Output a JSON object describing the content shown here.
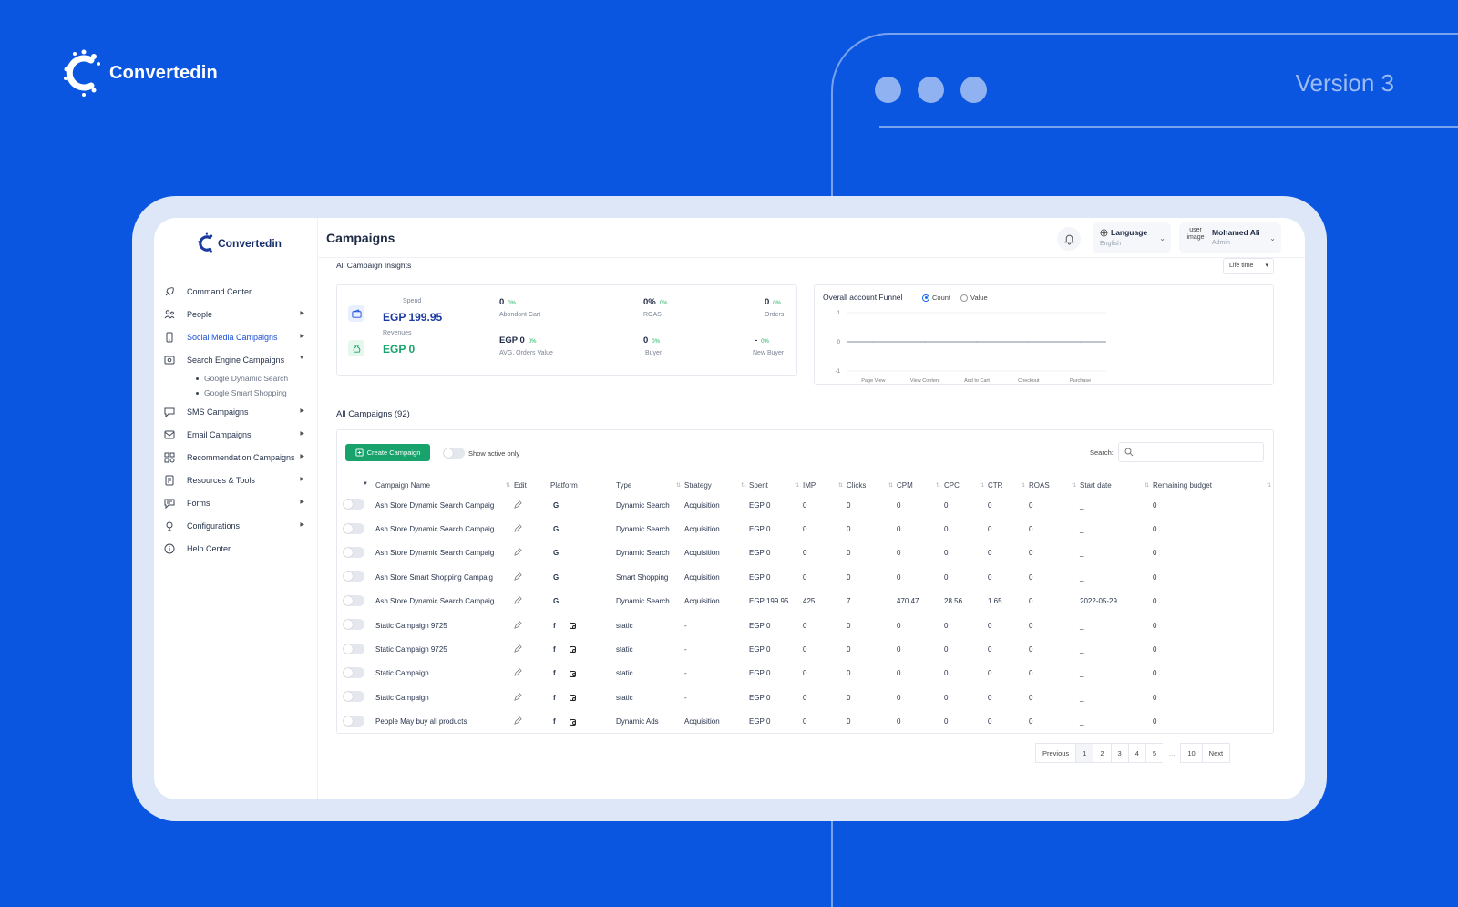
{
  "backdrop": {
    "brand": "Convertedin",
    "version": "Version 3"
  },
  "sidebar": {
    "brand": "Convertedin",
    "items": [
      {
        "label": "Command Center",
        "icon": "rocket-icon",
        "has_chevron": false
      },
      {
        "label": "People",
        "icon": "people-icon",
        "has_chevron": true
      },
      {
        "label": "Social Media Campaigns",
        "icon": "phone-icon",
        "has_chevron": true,
        "active": true
      },
      {
        "label": "Search Engine Campaigns",
        "icon": "search-engine-icon",
        "has_chevron": true,
        "expanded": true
      },
      {
        "label": "SMS Campaigns",
        "icon": "sms-icon",
        "has_chevron": true
      },
      {
        "label": "Email Campaigns",
        "icon": "email-icon",
        "has_chevron": true
      },
      {
        "label": "Recommendation Campaigns",
        "icon": "grid-icon",
        "has_chevron": true
      },
      {
        "label": "Resources & Tools",
        "icon": "tools-icon",
        "has_chevron": true
      },
      {
        "label": "Forms",
        "icon": "forms-icon",
        "has_chevron": true
      },
      {
        "label": "Configurations",
        "icon": "config-icon",
        "has_chevron": true
      },
      {
        "label": "Help Center",
        "icon": "help-icon",
        "has_chevron": false
      }
    ],
    "sub_items": [
      "Google Dynamic Search",
      "Google Smart Shopping"
    ]
  },
  "header": {
    "title": "Campaigns",
    "language_label": "Language",
    "language_value": "English",
    "user_image_alt": "user image",
    "user_name": "Mohamed Ali",
    "user_role": "Admin"
  },
  "insights": {
    "title": "All Campaign Insights",
    "period": "Life time",
    "spend_label": "Spend",
    "spend_value": "EGP 199.95",
    "revenues_label": "Revenues",
    "revenues_value": "EGP 0",
    "metrics": [
      {
        "value": "0",
        "pct": "0%",
        "label": "Abondont Cart"
      },
      {
        "value": "0%",
        "pct": "0%",
        "label": "ROAS"
      },
      {
        "value": "0",
        "pct": "0%",
        "label": "Orders"
      },
      {
        "value": "EGP 0",
        "pct": "0%",
        "label": "AVG. Orders Value"
      },
      {
        "value": "0",
        "pct": "0%",
        "label": "Buyer"
      },
      {
        "value": "-",
        "pct": "0%",
        "label": "New Buyer"
      }
    ]
  },
  "funnel": {
    "title": "Overall account Funnel",
    "option_count": "Count",
    "option_value": "Value",
    "selected": "Count",
    "y_ticks": [
      "1",
      "0",
      "-1"
    ],
    "x_ticks": [
      "Page View",
      "View Content",
      "Add to Cart",
      "Checkout",
      "Purchase"
    ],
    "values": [
      0,
      0,
      0,
      0,
      0
    ]
  },
  "campaigns": {
    "title": "All Campaigns (92)",
    "create_label": "Create Campaign",
    "show_active_label": "Show active only",
    "search_label": "Search:",
    "columns": [
      "Campaign Name",
      "Edit",
      "Platform",
      "Type",
      "Strategy",
      "Spent",
      "IMP.",
      "Clicks",
      "CPM",
      "CPC",
      "CTR",
      "ROAS",
      "Start date",
      "Remaining budget"
    ],
    "rows": [
      {
        "name": "Ash Store Dynamic Search Campaig",
        "platform": "google",
        "type": "Dynamic Search",
        "strategy": "Acquisition",
        "spent": "EGP 0",
        "imp": "0",
        "clicks": "0",
        "cpm": "0",
        "cpc": "0",
        "ctr": "0",
        "roas": "0",
        "start": "_",
        "budget": "0"
      },
      {
        "name": "Ash Store Dynamic Search Campaig",
        "platform": "google",
        "type": "Dynamic Search",
        "strategy": "Acquisition",
        "spent": "EGP 0",
        "imp": "0",
        "clicks": "0",
        "cpm": "0",
        "cpc": "0",
        "ctr": "0",
        "roas": "0",
        "start": "_",
        "budget": "0"
      },
      {
        "name": "Ash Store Dynamic Search Campaig",
        "platform": "google",
        "type": "Dynamic Search",
        "strategy": "Acquisition",
        "spent": "EGP 0",
        "imp": "0",
        "clicks": "0",
        "cpm": "0",
        "cpc": "0",
        "ctr": "0",
        "roas": "0",
        "start": "_",
        "budget": "0"
      },
      {
        "name": "Ash Store Smart Shopping Campaig",
        "platform": "google",
        "type": "Smart Shopping",
        "strategy": "Acquisition",
        "spent": "EGP 0",
        "imp": "0",
        "clicks": "0",
        "cpm": "0",
        "cpc": "0",
        "ctr": "0",
        "roas": "0",
        "start": "_",
        "budget": "0"
      },
      {
        "name": "Ash Store Dynamic Search Campaig",
        "platform": "google",
        "type": "Dynamic Search",
        "strategy": "Acquisition",
        "spent": "EGP 199.95",
        "imp": "425",
        "clicks": "7",
        "cpm": "470.47",
        "cpc": "28.56",
        "ctr": "1.65",
        "roas": "0",
        "start": "2022-05-29",
        "budget": "0"
      },
      {
        "name": "Static Campaign 9725",
        "platform": "meta",
        "type": "static",
        "strategy": "-",
        "spent": "EGP 0",
        "imp": "0",
        "clicks": "0",
        "cpm": "0",
        "cpc": "0",
        "ctr": "0",
        "roas": "0",
        "start": "_",
        "budget": "0"
      },
      {
        "name": "Static Campaign 9725",
        "platform": "meta",
        "type": "static",
        "strategy": "-",
        "spent": "EGP 0",
        "imp": "0",
        "clicks": "0",
        "cpm": "0",
        "cpc": "0",
        "ctr": "0",
        "roas": "0",
        "start": "_",
        "budget": "0"
      },
      {
        "name": "Static Campaign",
        "platform": "meta",
        "type": "static",
        "strategy": "-",
        "spent": "EGP 0",
        "imp": "0",
        "clicks": "0",
        "cpm": "0",
        "cpc": "0",
        "ctr": "0",
        "roas": "0",
        "start": "_",
        "budget": "0"
      },
      {
        "name": "Static Campaign",
        "platform": "meta",
        "type": "static",
        "strategy": "-",
        "spent": "EGP 0",
        "imp": "0",
        "clicks": "0",
        "cpm": "0",
        "cpc": "0",
        "ctr": "0",
        "roas": "0",
        "start": "_",
        "budget": "0"
      },
      {
        "name": "People May buy all products",
        "platform": "meta",
        "type": "Dynamic Ads",
        "strategy": "Acquisition",
        "spent": "EGP 0",
        "imp": "0",
        "clicks": "0",
        "cpm": "0",
        "cpc": "0",
        "ctr": "0",
        "roas": "0",
        "start": "_",
        "budget": "0"
      }
    ]
  },
  "pagination": {
    "previous": "Previous",
    "pages": [
      "1",
      "2",
      "3",
      "4",
      "5"
    ],
    "ellipsis": "...",
    "last": "10",
    "next": "Next",
    "current": "1"
  },
  "colors": {
    "background": "#0b56e0",
    "accent": "#1a4fd6",
    "success": "#17a36b",
    "positive_pct": "#18b35e"
  }
}
